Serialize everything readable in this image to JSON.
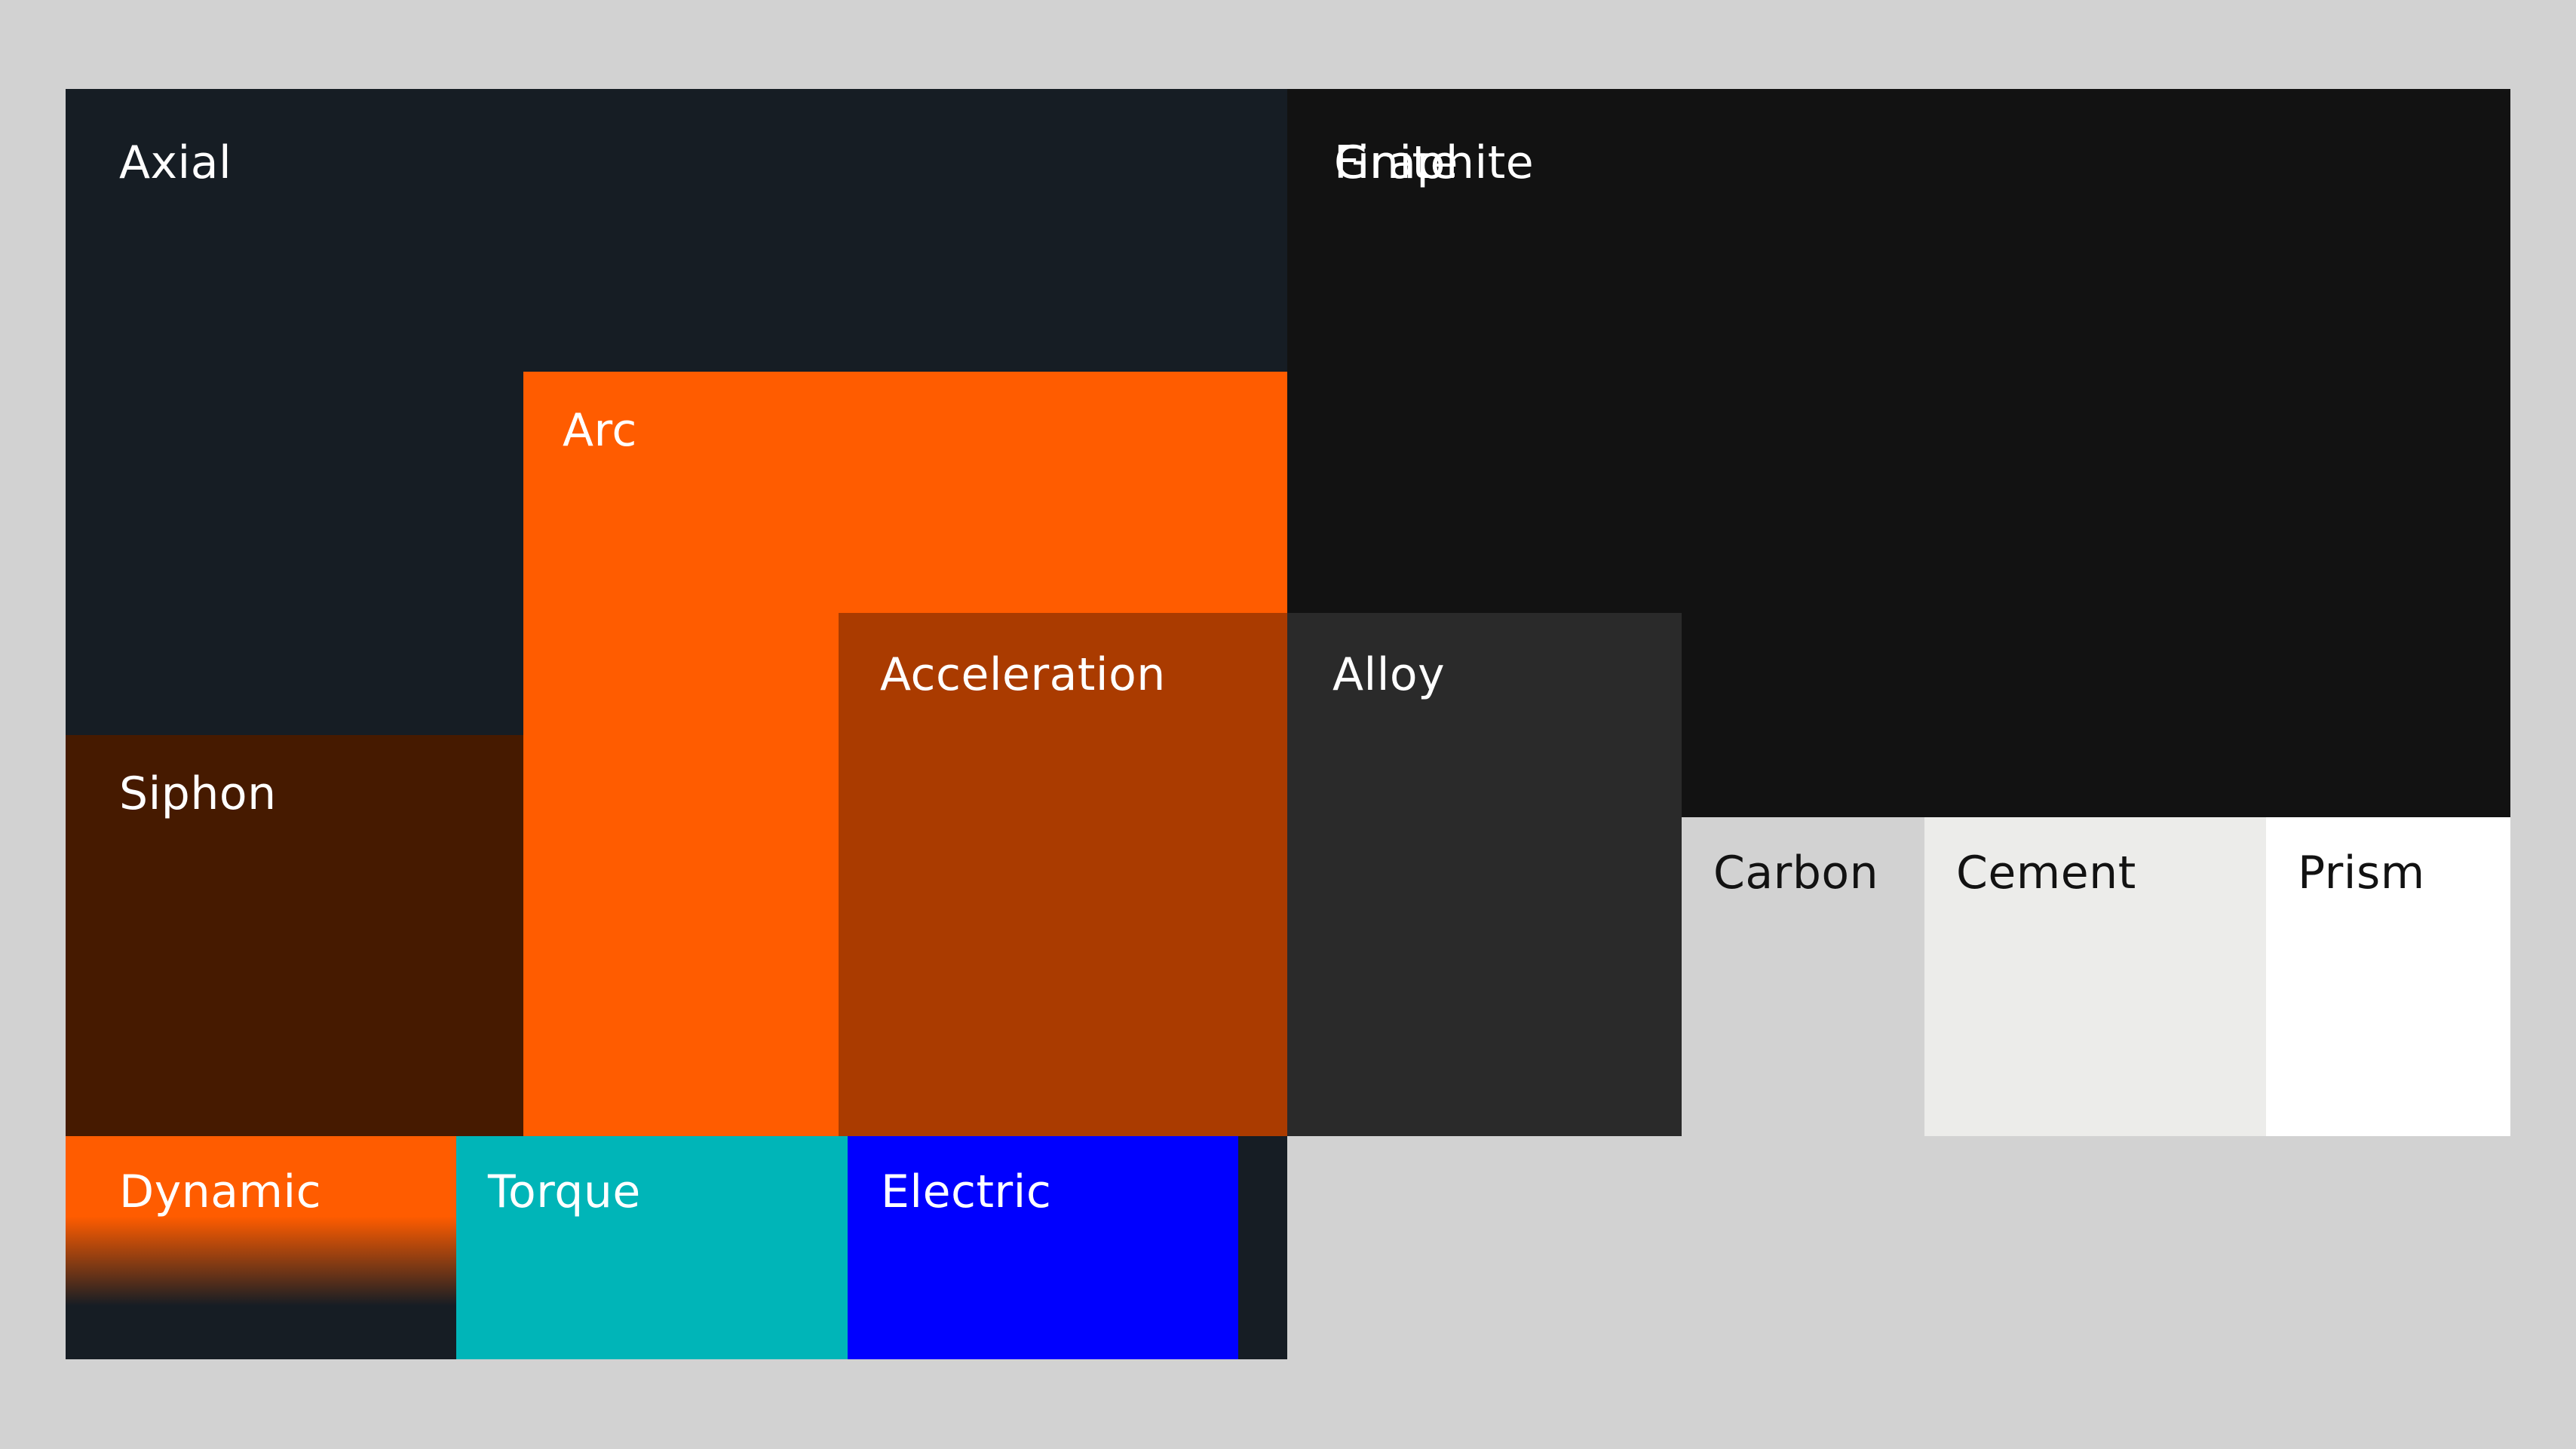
{
  "swatches": {
    "axial": {
      "label": "Axial",
      "color": "#161d24",
      "text_color": "#ffffff"
    },
    "finite": {
      "label": "Finite",
      "color": "#121212",
      "text_color": "#ffffff"
    },
    "graphite": {
      "label": "Graphite",
      "color": "#121212",
      "text_color": "#ffffff"
    },
    "arc": {
      "label": "Arc",
      "color": "#ff5c00",
      "text_color": "#ffffff"
    },
    "siphon": {
      "label": "Siphon",
      "color": "#461a00",
      "text_color": "#ffffff"
    },
    "acceleration": {
      "label": "Acceleration",
      "color": "#aa3b00",
      "text_color": "#ffffff"
    },
    "alloy": {
      "label": "Alloy",
      "color": "#2a2a2a",
      "text_color": "#ffffff"
    },
    "carbon": {
      "label": "Carbon",
      "color": "#d2d2d2",
      "text_color": "#121212"
    },
    "cement": {
      "label": "Cement",
      "color": "#ececea",
      "text_color": "#121212"
    },
    "prism": {
      "label": "Prism",
      "color": "#ffffff",
      "text_color": "#121212"
    },
    "dynamic": {
      "label": "Dynamic",
      "gradient": [
        "#ff5c00",
        "#161d24"
      ],
      "text_color": "#ffffff"
    },
    "torque": {
      "label": "Torque",
      "color": "#00b5b8",
      "text_color": "#ffffff"
    },
    "electric": {
      "label": "Electric",
      "color": "#0000ff",
      "text_color": "#ffffff"
    }
  }
}
